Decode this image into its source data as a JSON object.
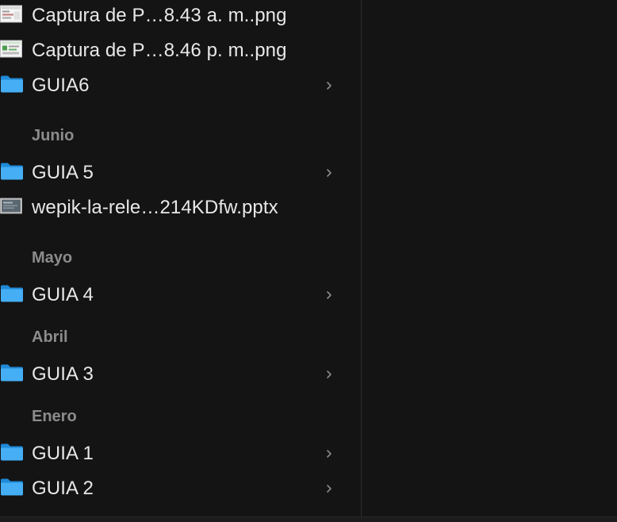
{
  "files": {
    "recent": [
      {
        "label": "Captura de P…8.43 a. m..png",
        "kind": "image"
      },
      {
        "label": "Captura de P…8.46 p. m..png",
        "kind": "image"
      },
      {
        "label": "GUIA6",
        "kind": "folder"
      }
    ],
    "junio": {
      "header": "Junio",
      "items": [
        {
          "label": "GUIA 5",
          "kind": "folder"
        },
        {
          "label": "wepik-la-rele…214KDfw.pptx",
          "kind": "presentation"
        }
      ]
    },
    "mayo": {
      "header": "Mayo",
      "items": [
        {
          "label": "GUIA 4",
          "kind": "folder"
        }
      ]
    },
    "abril": {
      "header": "Abril",
      "items": [
        {
          "label": "GUIA 3",
          "kind": "folder"
        }
      ]
    },
    "enero": {
      "header": "Enero",
      "items": [
        {
          "label": "GUIA 1",
          "kind": "folder"
        },
        {
          "label": "GUIA 2",
          "kind": "folder"
        }
      ]
    }
  },
  "colors": {
    "background": "#141414",
    "folder": "#3fa9f5",
    "section_header": "#8c8c8c",
    "text": "#e8e8e8"
  },
  "icons": {
    "folder": "folder-icon",
    "image": "image-file-icon",
    "presentation": "presentation-file-icon",
    "chevron": "chevron-right-icon"
  }
}
